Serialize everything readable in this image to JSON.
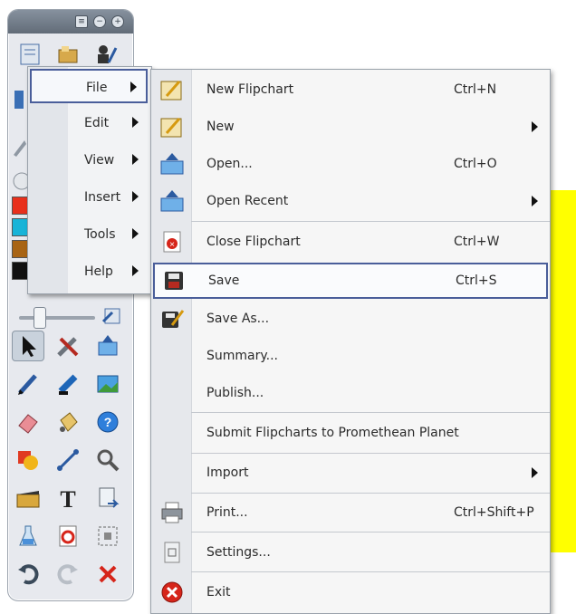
{
  "main_menu": {
    "items": [
      {
        "label": "File",
        "has_submenu": true,
        "selected": true
      },
      {
        "label": "Edit",
        "has_submenu": true
      },
      {
        "label": "View",
        "has_submenu": true
      },
      {
        "label": "Insert",
        "has_submenu": true
      },
      {
        "label": "Tools",
        "has_submenu": true
      },
      {
        "label": "Help",
        "has_submenu": true
      }
    ]
  },
  "file_menu": {
    "items": [
      {
        "label": "New Flipchart",
        "shortcut": "Ctrl+N",
        "icon": "new-flipchart-icon"
      },
      {
        "label": "New",
        "has_submenu": true,
        "icon": "new-icon"
      },
      {
        "label": "Open...",
        "shortcut": "Ctrl+O",
        "icon": "open-icon"
      },
      {
        "label": "Open Recent",
        "has_submenu": true,
        "icon": "open-recent-icon"
      },
      {
        "label": "Close Flipchart",
        "shortcut": "Ctrl+W",
        "icon": "close-flipchart-icon"
      },
      {
        "label": "Save",
        "shortcut": "Ctrl+S",
        "icon": "save-icon",
        "selected": true
      },
      {
        "label": "Save As...",
        "icon": "save-as-icon"
      },
      {
        "label": "Summary...",
        "icon": ""
      },
      {
        "label": "Publish...",
        "icon": ""
      },
      {
        "label": "Submit Flipcharts to Promethean Planet",
        "icon": ""
      },
      {
        "label": "Import",
        "has_submenu": true,
        "icon": ""
      },
      {
        "label": "Print...",
        "shortcut": "Ctrl+Shift+P",
        "icon": "printer-icon"
      },
      {
        "label": "Settings...",
        "icon": "settings-icon"
      },
      {
        "label": "Exit",
        "icon": "exit-icon"
      }
    ]
  },
  "colors": {
    "selection_border": "#4a5e9a",
    "highlight_yellow": "#ffff00",
    "swatches": [
      "#e8301c",
      "#18b4d8",
      "#a86414",
      "#111111"
    ]
  }
}
